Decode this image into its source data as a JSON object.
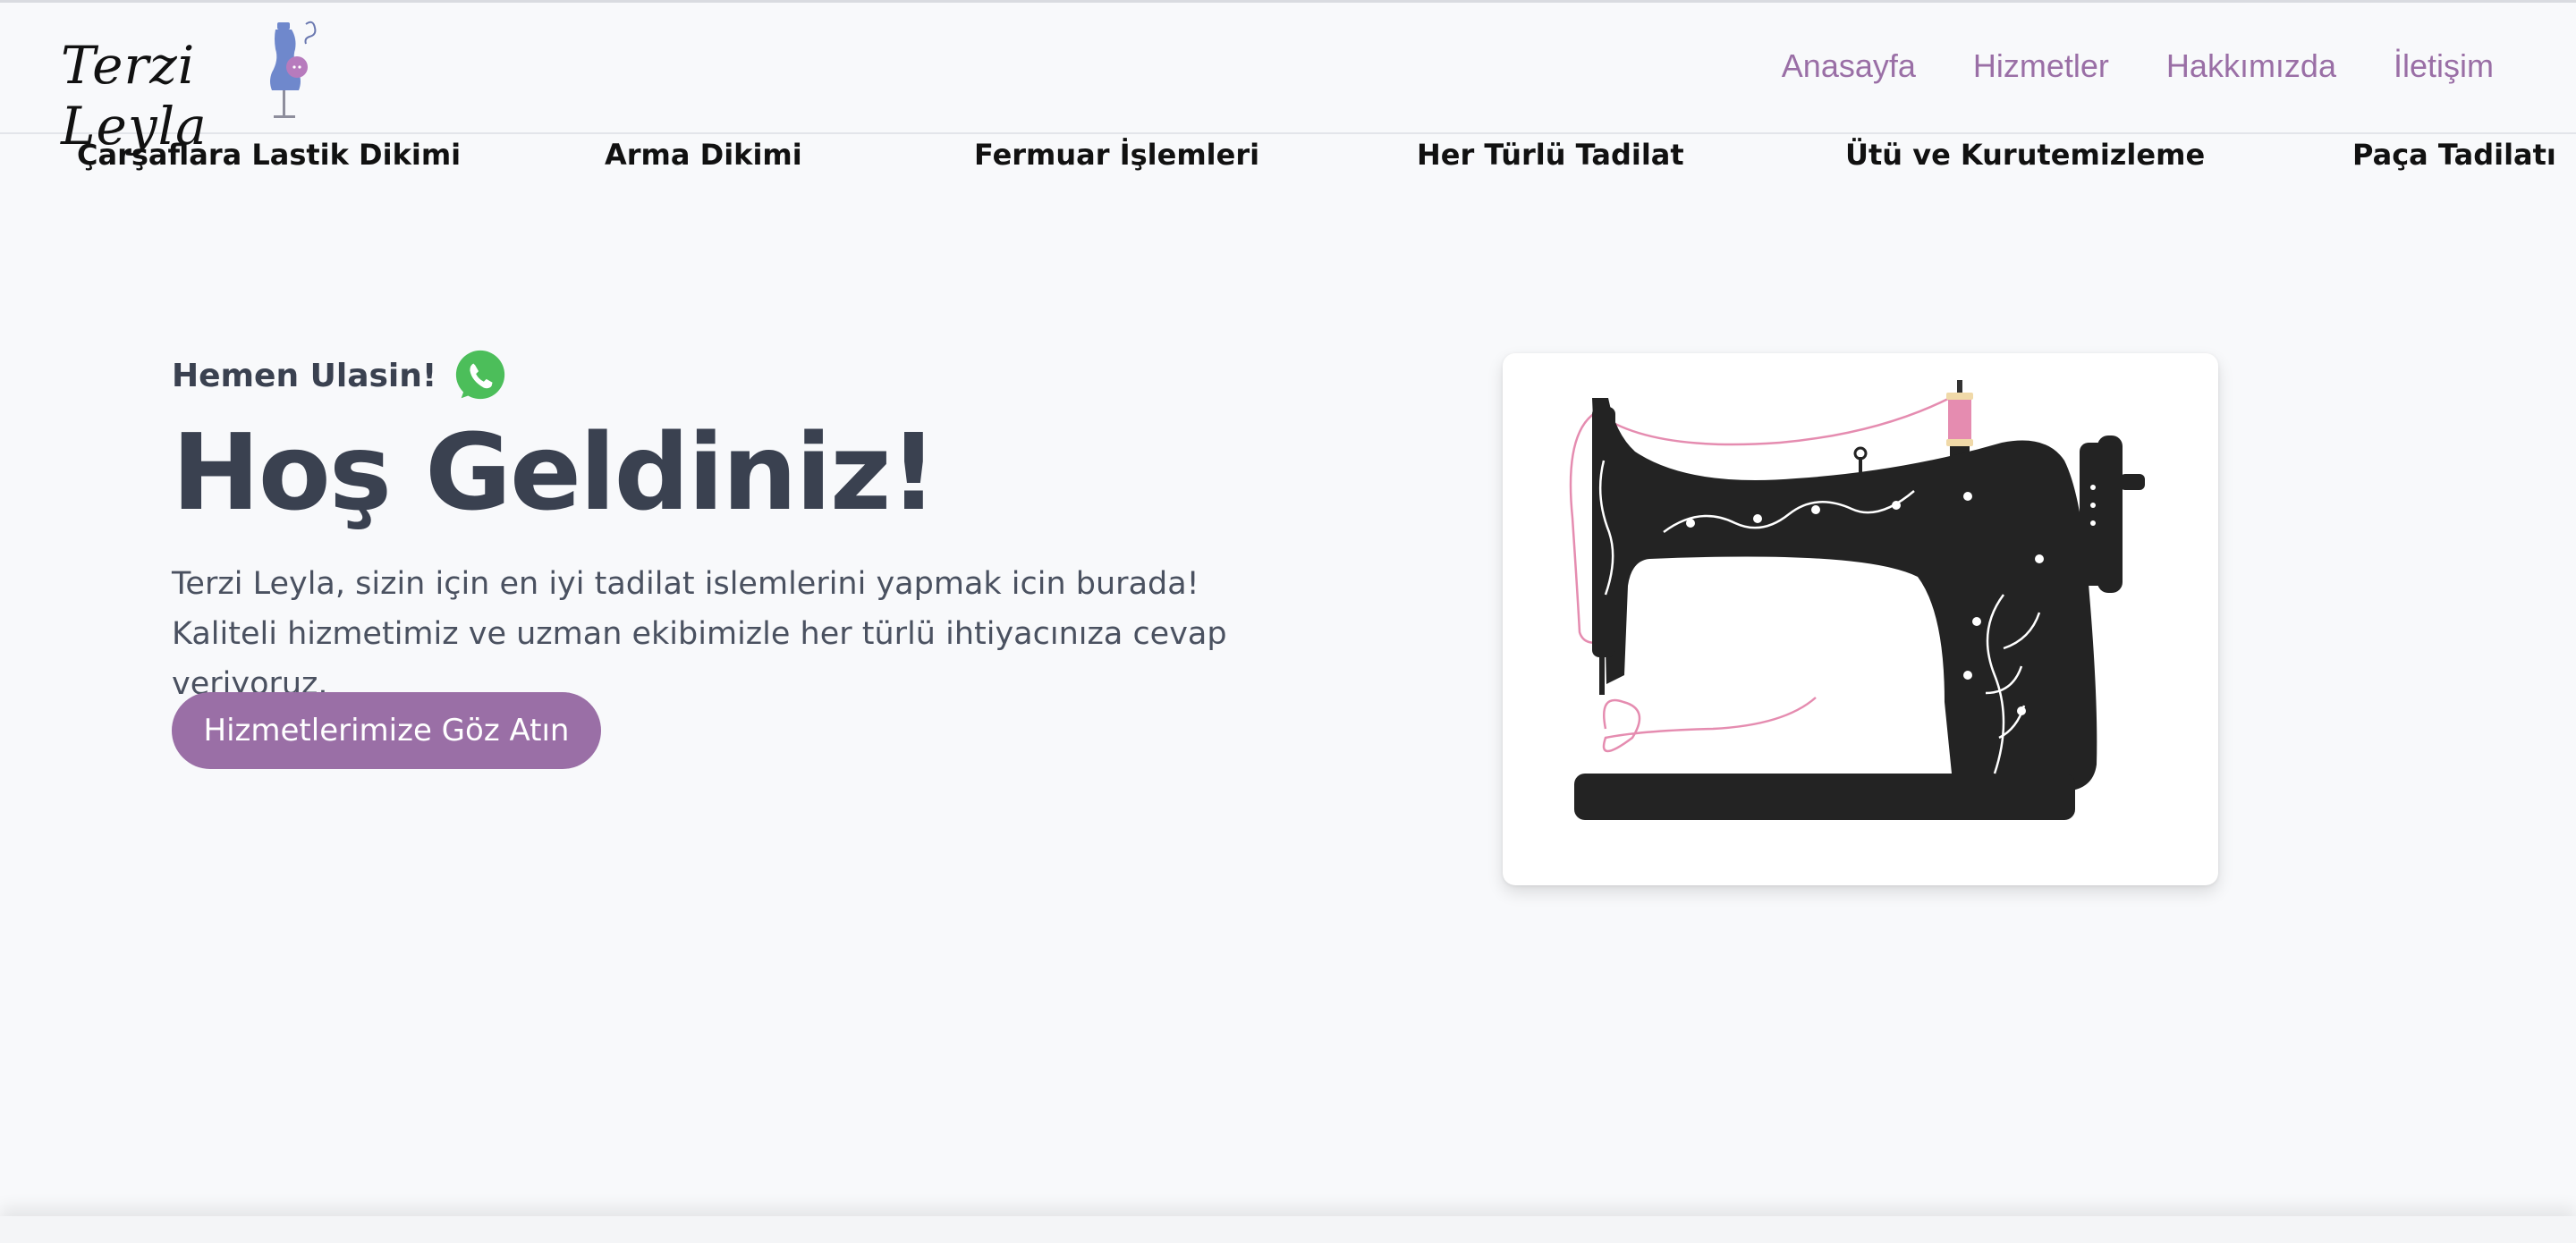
{
  "header": {
    "logo_text": "Terzi Leyla",
    "nav": [
      "Anasayfa",
      "Hizmetler",
      "Hakkımızda",
      "İletişim"
    ]
  },
  "services": [
    "Çarşaflara Lastik Dikimi",
    "Arma Dikimi",
    "Fermuar İşlemleri",
    "Her Türlü Tadilat",
    "Ütü ve Kurutemizleme",
    "Paça Tadilatı"
  ],
  "hero": {
    "contact_label": "Hemen Ulasin!",
    "title": "Hoş Geldiniz!",
    "description": "Terzi Leyla, sizin için en iyi tadilat islemlerini yapmak icin burada! Kaliteli hizmetimiz ve uzman ekibimizle her türlü ihtiyacınıza cevap veriyoruz.",
    "cta_label": "Hizmetlerimize Göz Atın"
  },
  "colors": {
    "accent": "#9a6fa6",
    "text_dark": "#3a4150",
    "background": "#f8f9fb",
    "whatsapp": "#4cbe5a"
  },
  "icons": {
    "logo_figure": "dress-form-icon",
    "contact": "whatsapp-icon",
    "hero_image": "sewing-machine-illustration"
  }
}
